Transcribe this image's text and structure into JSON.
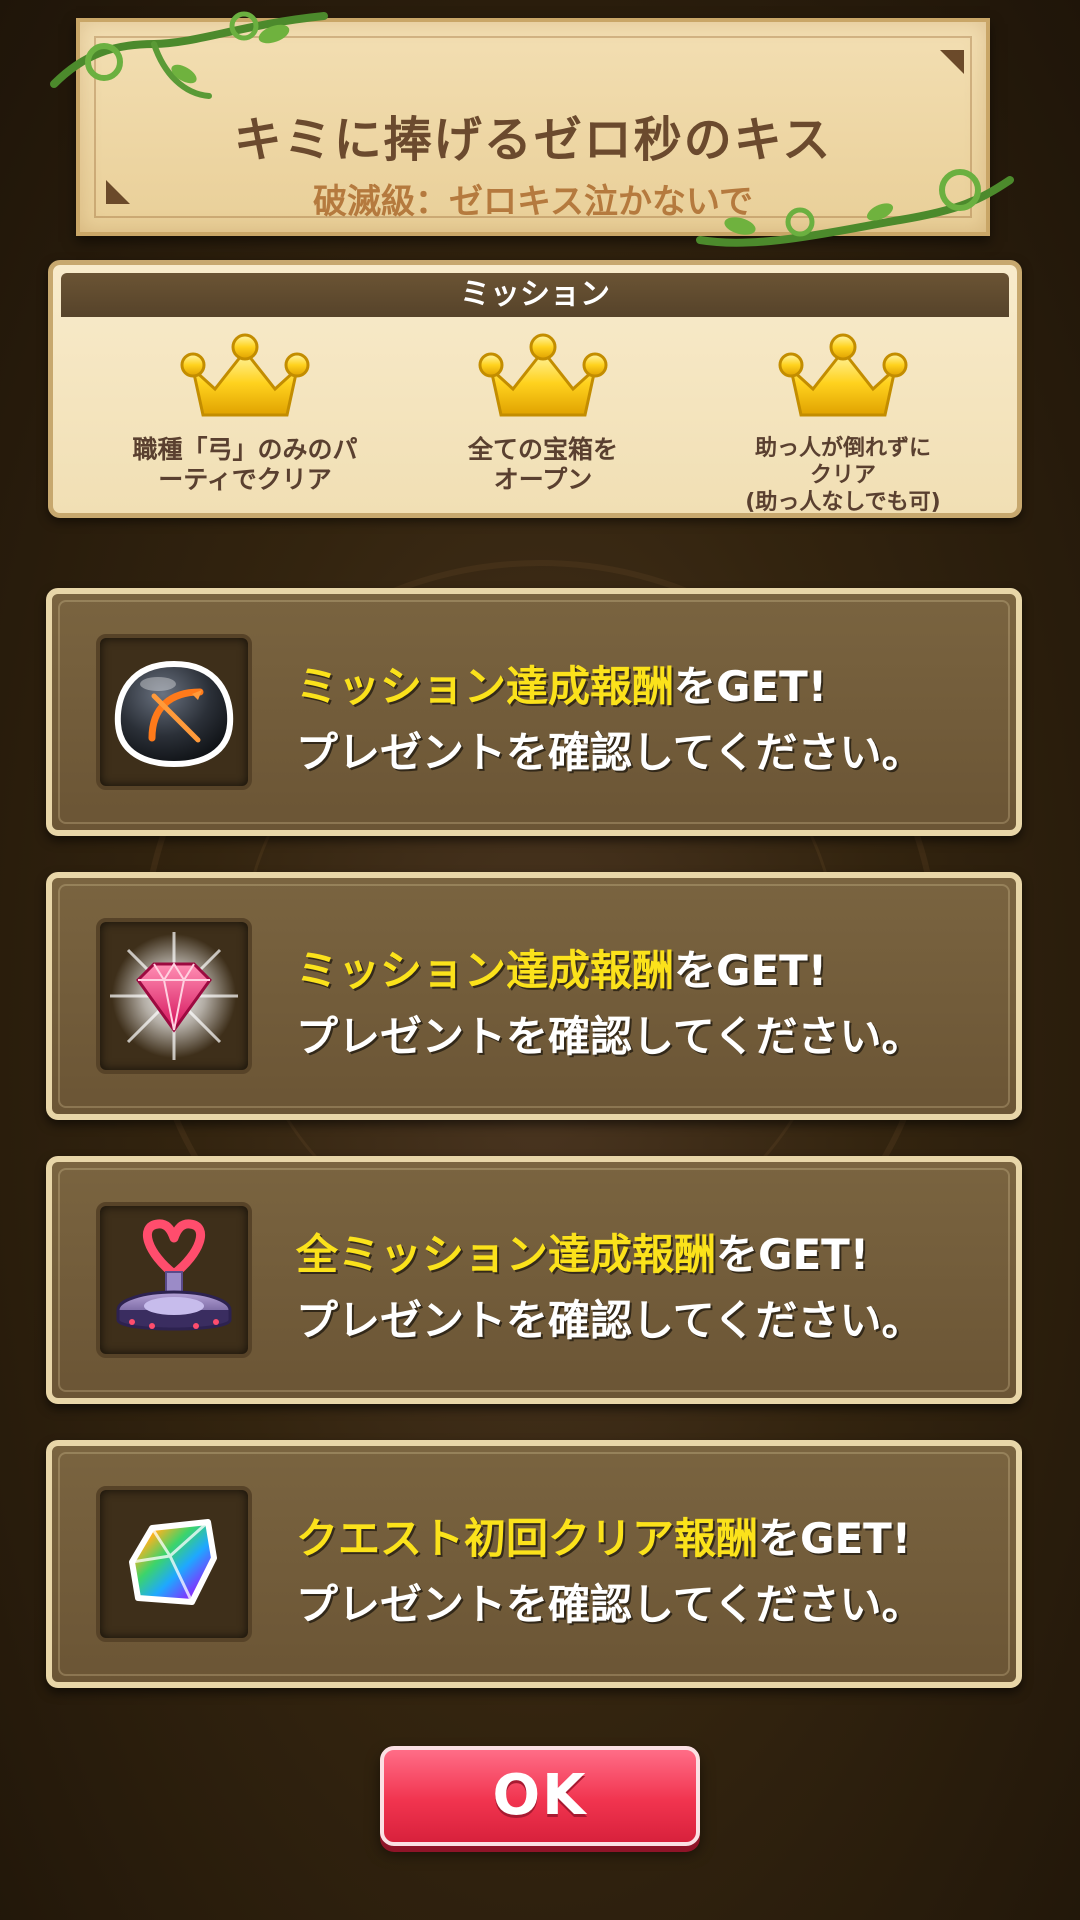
{
  "quest": {
    "title": "キミに捧げるゼロ秒のキス",
    "subtitle": "破滅級：ゼロキス泣かないで"
  },
  "mission_panel": {
    "header": "ミッション",
    "items": [
      {
        "label": "職種「弓」のみのパ\nーティでクリア",
        "icon": "crown-icon"
      },
      {
        "label": "全ての宝箱を\nオープン",
        "icon": "crown-icon"
      },
      {
        "label": "助っ人が倒れずに\nクリア\n(助っ人なしでも可)",
        "icon": "crown-icon"
      }
    ]
  },
  "rewards": [
    {
      "highlight": "ミッション達成報酬",
      "suffix": "をGET!",
      "line2": "プレゼントを確認してください。",
      "icon": "bow-orb-icon"
    },
    {
      "highlight": "ミッション達成報酬",
      "suffix": "をGET!",
      "line2": "プレゼントを確認してください。",
      "icon": "pink-gem-icon"
    },
    {
      "highlight": "全ミッション達成報酬",
      "suffix": "をGET!",
      "line2": "プレゼントを確認してください。",
      "icon": "heart-statue-icon"
    },
    {
      "highlight": "クエスト初回クリア報酬",
      "suffix": "をGET!",
      "line2": "プレゼントを確認してください。",
      "icon": "rainbow-crystal-icon"
    }
  ],
  "ok_button": {
    "label": "OK"
  },
  "colors": {
    "highlight_text": "#fbe21b",
    "ok_button": "#f1344f",
    "panel_cream": "#f3dfb3",
    "card_brown": "#74603c"
  }
}
